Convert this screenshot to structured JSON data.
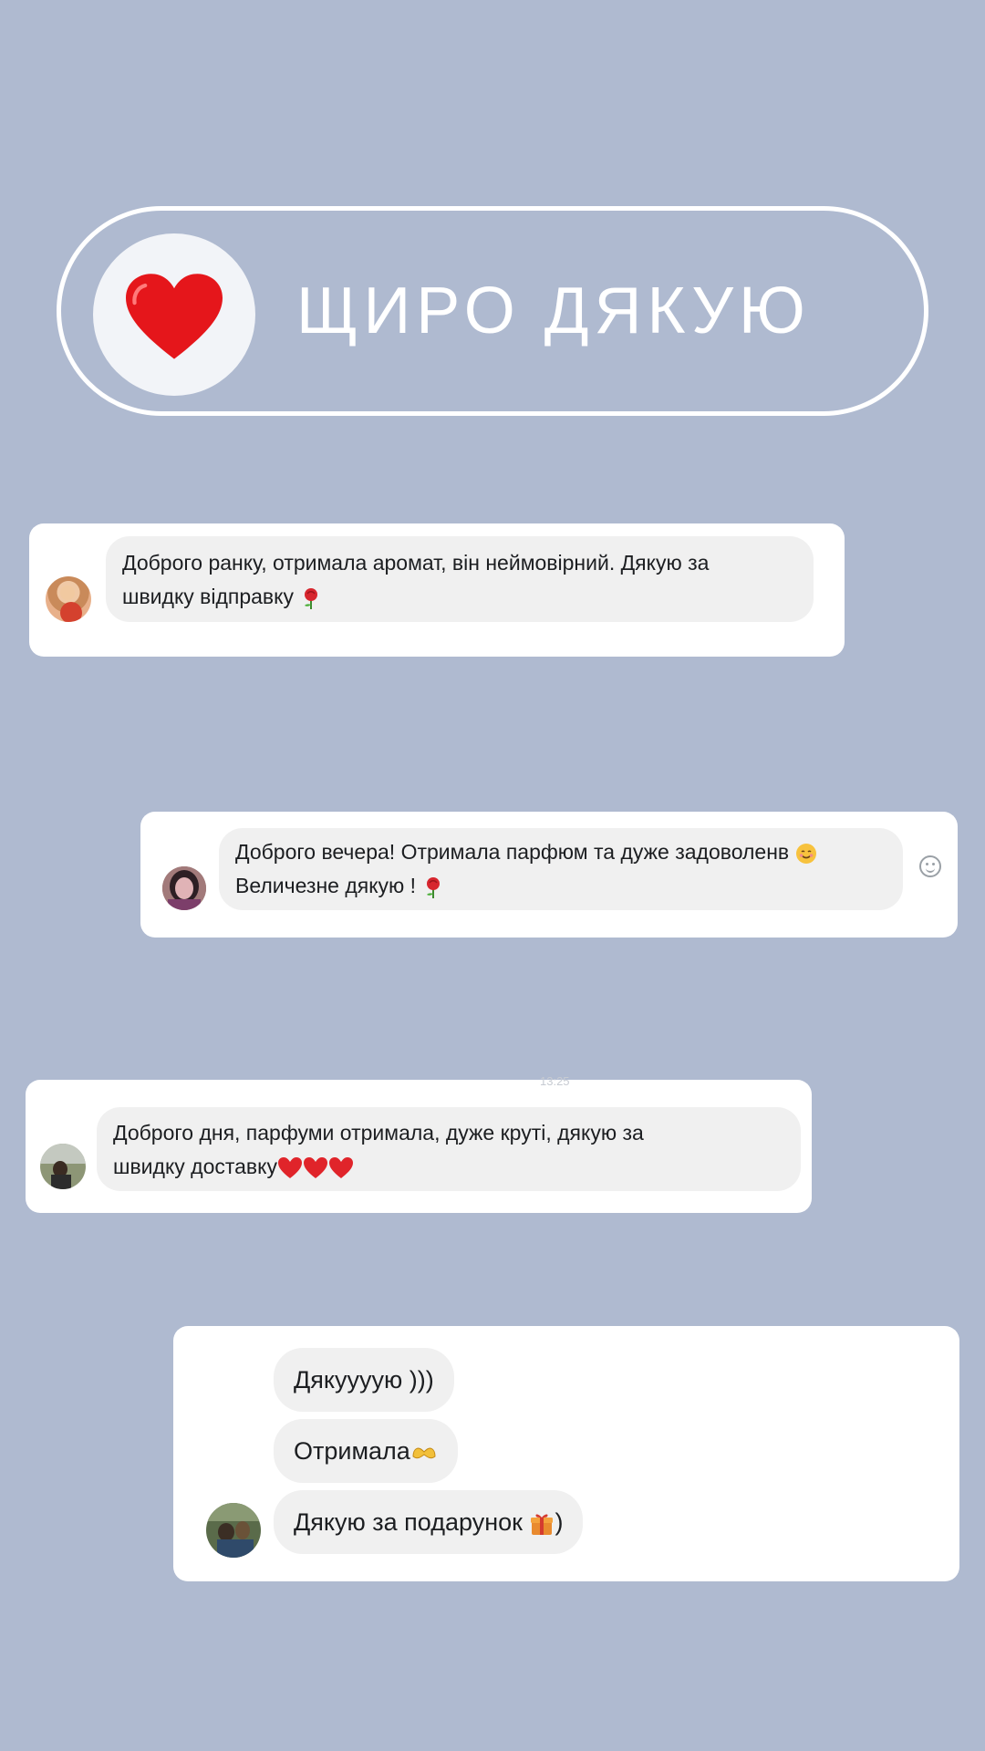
{
  "header": {
    "title": "ЩИРО ДЯКУЮ"
  },
  "reviews": [
    {
      "lines": [
        "Доброго ранку, отримала аромат, він неймовірний. Дякую за",
        "швидку відправку"
      ],
      "trailing_emoji": "rose"
    },
    {
      "lines": [
        "Доброго вечера! Отримала парфюм та дуже задоволенв",
        "Величезне дякую !"
      ],
      "trailing_emoji": "rose",
      "inline_emoji": "smiling-face"
    },
    {
      "timestamp": "13:25",
      "lines": [
        "Доброго дня, парфуми отримала, дуже круті, дякую за",
        "швидку доставку"
      ],
      "trailing_emoji": "three-red-hearts"
    },
    {
      "messages": [
        "Дякуууую )))",
        "Отримала",
        "Дякую за подарунок"
      ],
      "emojis": [
        "",
        "heart-hands",
        "gift"
      ],
      "suffixes": [
        "",
        "",
        ")"
      ]
    }
  ]
}
